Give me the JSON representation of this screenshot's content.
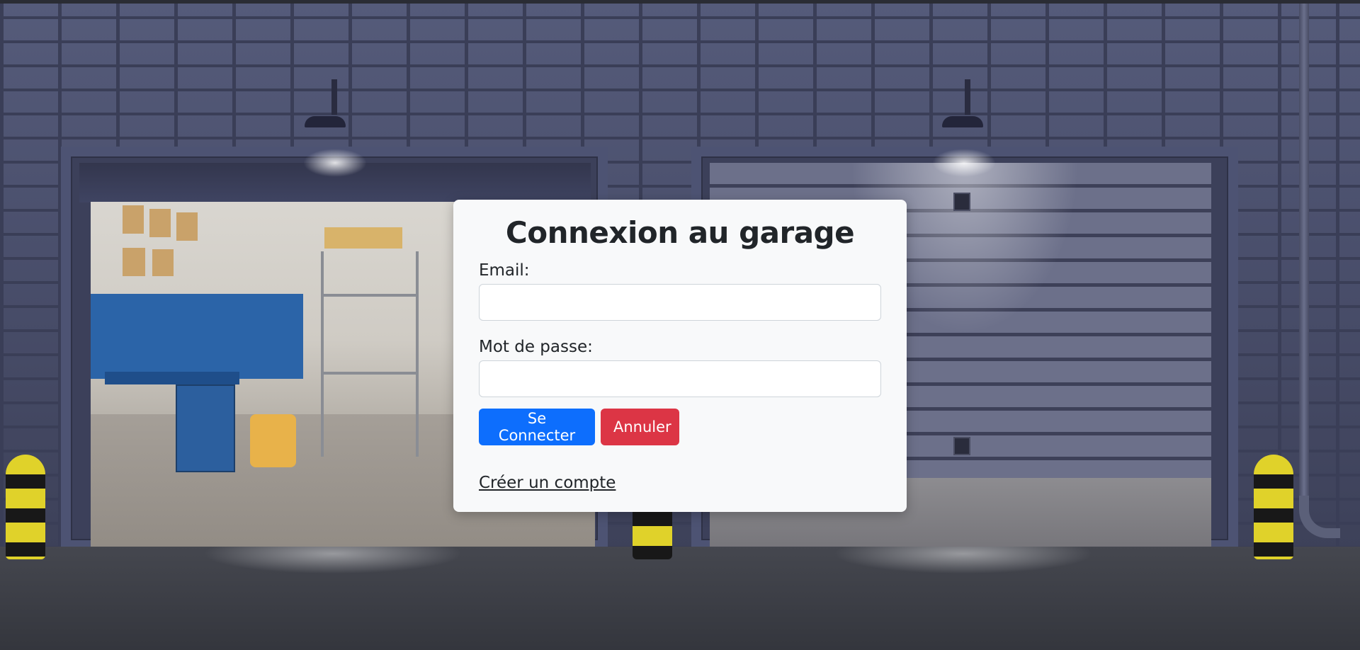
{
  "login": {
    "title": "Connexion au garage",
    "email_label": "Email:",
    "email_value": "",
    "password_label": "Mot de passe:",
    "password_value": "",
    "submit_label": "Se Connecter",
    "cancel_label": "Annuler",
    "create_account_label": "Créer un compte"
  },
  "colors": {
    "primary": "#0d6efd",
    "danger": "#dc3545",
    "card_background": "#f8f9fa"
  },
  "background": {
    "scene": "garage-night-background"
  }
}
